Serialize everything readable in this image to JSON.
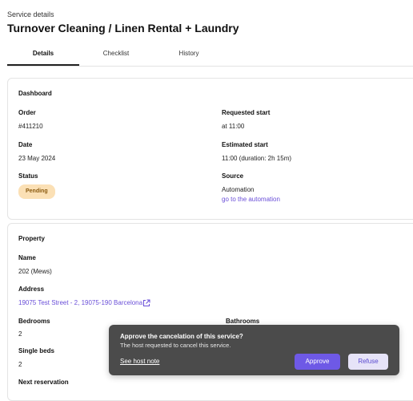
{
  "header": {
    "eyebrow": "Service details",
    "title": "Turnover Cleaning / Linen Rental + Laundry"
  },
  "tabs": [
    {
      "label": "Details",
      "active": true
    },
    {
      "label": "Checklist",
      "active": false
    },
    {
      "label": "History",
      "active": false
    }
  ],
  "dashboard": {
    "title": "Dashboard",
    "order_label": "Order",
    "order_value": "#411210",
    "requested_start_label": "Requested start",
    "requested_start_value": "at 11:00",
    "date_label": "Date",
    "date_value": "23 May 2024",
    "estimated_start_label": "Estimated start",
    "estimated_start_value": "11:00 (duration: 2h 15m)",
    "status_label": "Status",
    "status_value": "Pending",
    "source_label": "Source",
    "source_value": "Automation",
    "source_link": "go to the automation"
  },
  "property": {
    "title": "Property",
    "name_label": "Name",
    "name_value": "202 (Mews)",
    "address_label": "Address",
    "address_value": "19075 Test Street - 2, 19075-190 Barcelona",
    "bedrooms_label": "Bedrooms",
    "bedrooms_value": "2",
    "bathrooms_label": "Bathrooms",
    "single_beds_label": "Single beds",
    "single_beds_value": "2",
    "next_reservation_label": "Next reservation"
  },
  "toast": {
    "title": "Approve the cancelation of this service?",
    "text": "The host requested to cancel this service.",
    "link": "See host note",
    "approve": "Approve",
    "refuse": "Refuse"
  },
  "colors": {
    "accent": "#6e59e6",
    "link": "#6a4fd8",
    "badge_bg": "#fbe0b5",
    "toast_bg": "#4b4b4b"
  }
}
